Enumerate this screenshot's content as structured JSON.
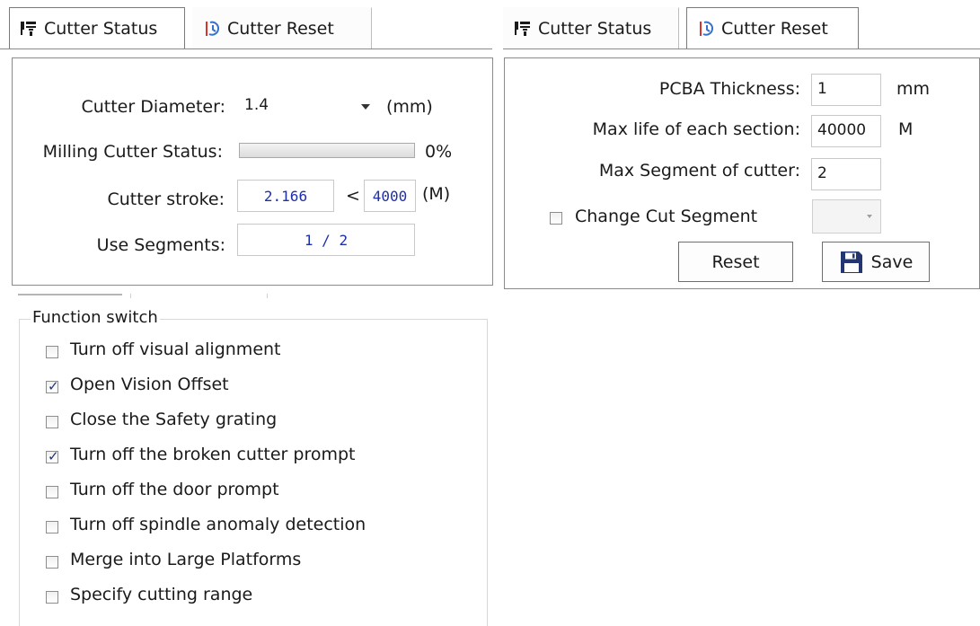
{
  "left_tabs": {
    "status_label": "Cutter Status",
    "reset_label": "Cutter Reset"
  },
  "right_tabs": {
    "status_label": "Cutter Status",
    "reset_label": "Cutter Reset"
  },
  "status_panel": {
    "diameter_label": "Cutter Diameter:",
    "diameter_value": "1.4",
    "diameter_unit": "(mm)",
    "milling_label": "Milling Cutter Status:",
    "milling_progress": 0,
    "milling_percent": "0%",
    "stroke_label": "Cutter stroke:",
    "stroke_value": "2.166",
    "stroke_compare": "<",
    "stroke_max": "4000",
    "stroke_unit": "(M)",
    "segments_label": "Use Segments:",
    "segments_value": "1 / 2"
  },
  "reset_panel": {
    "thickness_label": "PCBA Thickness:",
    "thickness_value": "1",
    "thickness_unit": "mm",
    "maxlife_label": "Max life of each section:",
    "maxlife_value": "40000",
    "maxlife_unit": "M",
    "maxseg_label": "Max Segment of cutter:",
    "maxseg_value": "2",
    "change_seg_label": "Change Cut Segment",
    "change_seg_checked": false,
    "reset_button": "Reset",
    "save_button": "Save"
  },
  "function_switch": {
    "title": "Function switch",
    "items": [
      {
        "label": "Turn off visual alignment",
        "checked": false
      },
      {
        "label": "Open Vision Offset",
        "checked": true
      },
      {
        "label": "Close the Safety grating",
        "checked": false
      },
      {
        "label": "Turn off the broken cutter prompt",
        "checked": true
      },
      {
        "label": "Turn off the door prompt",
        "checked": false
      },
      {
        "label": "Turn off spindle anomaly detection",
        "checked": false
      },
      {
        "label": "Merge into Large Platforms",
        "checked": false
      },
      {
        "label": "Specify cutting range",
        "checked": false
      }
    ]
  },
  "icons": {
    "status_icon": "cutter-status-icon",
    "reset_icon": "cutter-reset-icon",
    "save_icon": "floppy-disk-icon",
    "dropdown": "chevron-down-icon",
    "checkmark": "checkmark-icon"
  },
  "colors": {
    "value_text": "#1f2fa8",
    "icon_navy": "#23366f"
  }
}
